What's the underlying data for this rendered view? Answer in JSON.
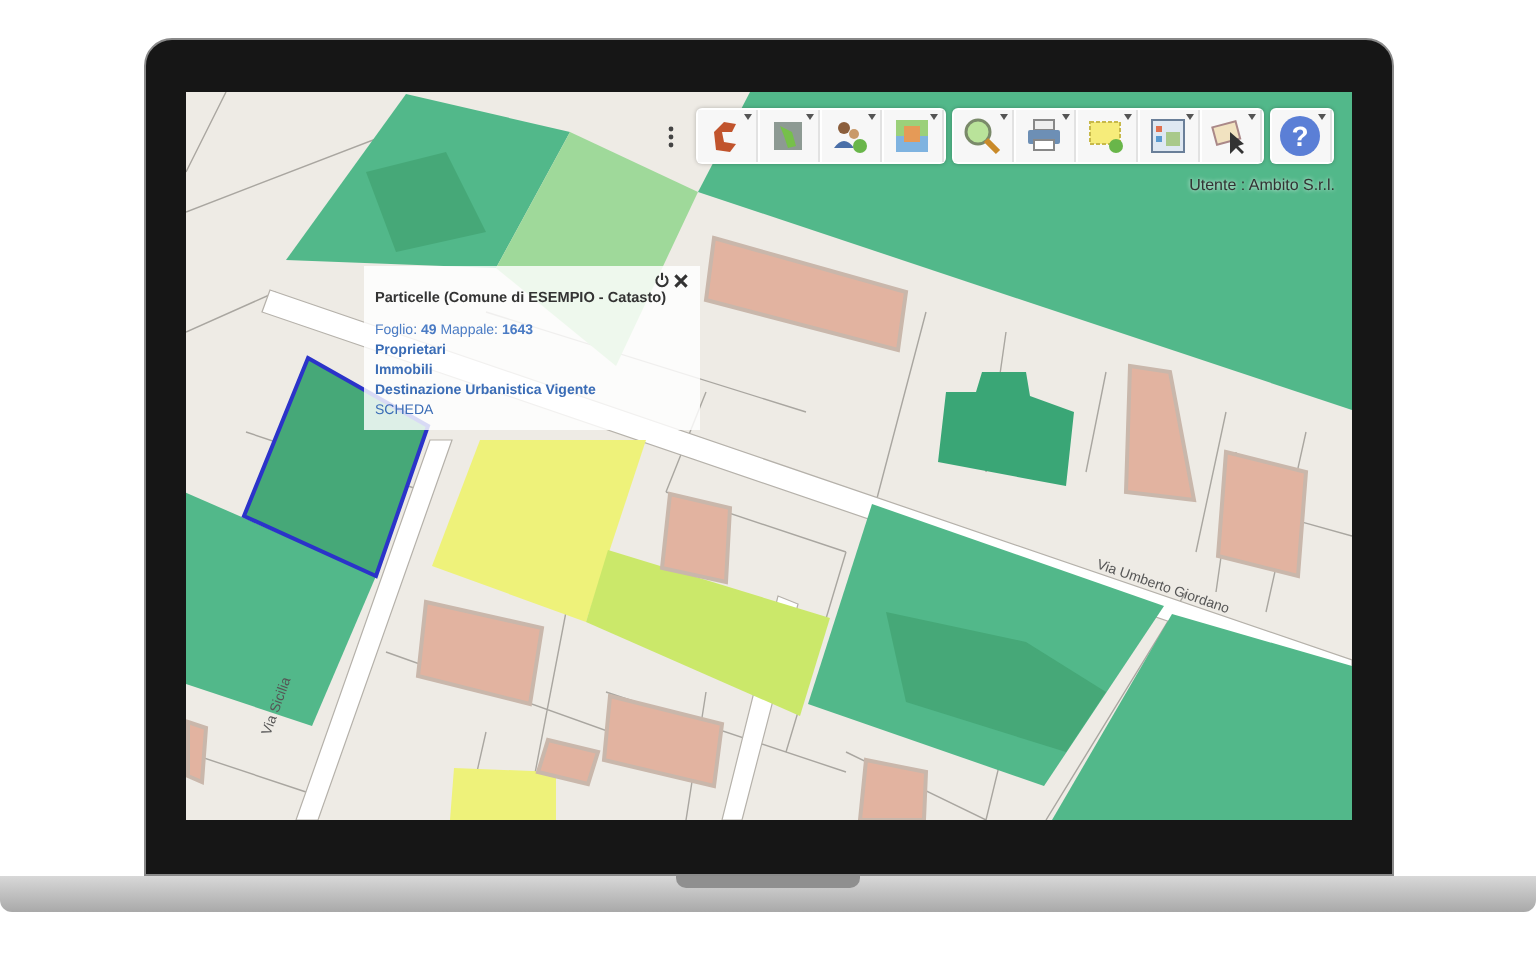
{
  "toolbar": {
    "help_button": {
      "label": "?"
    }
  },
  "user_label": "Utente : Ambito S.r.l.",
  "popup": {
    "title": "Particelle (Comune di ESEMPIO - Catasto)",
    "parcel_line": "Foglio: **49**  Mappale: **1643**",
    "links": [
      {
        "label": "Proprietari",
        "bold": true
      },
      {
        "label": "Immobili",
        "bold": true
      },
      {
        "label": "Destinazione Urbanistica Vigente",
        "bold": true
      },
      {
        "label": "SCHEDA",
        "bold": false
      }
    ]
  },
  "map": {
    "street_labels": [
      {
        "label": "Via Umberto Giordano"
      },
      {
        "label": "Via Sicilia"
      }
    ]
  }
}
